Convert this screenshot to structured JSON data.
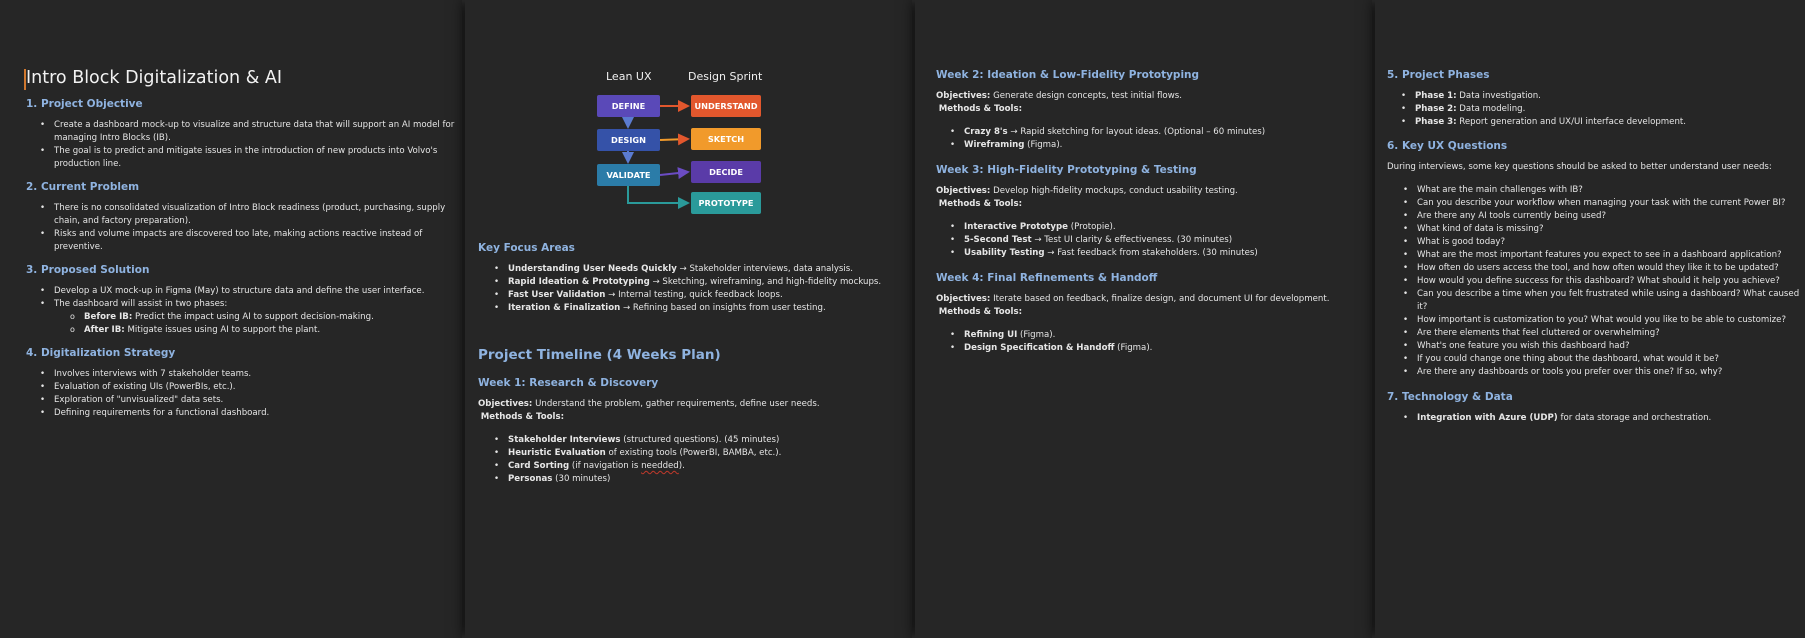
{
  "page1": {
    "title": "Intro Block Digitalization & AI",
    "sections": [
      {
        "heading": "1. Project Objective",
        "bullets": [
          "Create a dashboard mock-up to visualize and structure data that will support an AI model for managing Intro Blocks (IB).",
          "The goal is to predict and mitigate issues in the introduction of new products into Volvo's production line."
        ]
      },
      {
        "heading": "2. Current Problem",
        "bullets": [
          "There is no consolidated visualization of Intro Block readiness (product, purchasing, supply chain, and factory preparation).",
          "Risks and volume impacts are discovered too late, making actions reactive instead of preventive."
        ]
      },
      {
        "heading": "3. Proposed Solution",
        "bullets": [
          "Develop a UX mock-up in Figma (May) to structure data and define the user interface.",
          "The dashboard will assist in two phases:"
        ],
        "sub": [
          {
            "label": "Before IB:",
            "text": " Predict the impact using AI to support decision-making."
          },
          {
            "label": "After IB:",
            "text": " Mitigate issues using AI to support the plant."
          }
        ]
      },
      {
        "heading": "4. Digitalization Strategy",
        "bullets": [
          "Involves interviews with 7 stakeholder teams.",
          "Evaluation of existing UIs (PowerBIs, etc.).",
          "Exploration of \"unvisualized\" data sets.",
          "Defining requirements for a functional dashboard."
        ]
      }
    ]
  },
  "page2": {
    "diagram": {
      "left_header": "Lean UX",
      "right_header": "Design Sprint",
      "left_boxes": [
        "DEFINE",
        "DESIGN",
        "VALIDATE"
      ],
      "right_boxes": [
        "UNDERSTAND",
        "SKETCH",
        "DECIDE",
        "PROTOTYPE"
      ]
    },
    "focus_heading": "Key Focus Areas",
    "focus": [
      {
        "label": "Understanding User Needs Quickly",
        "text": " → Stakeholder interviews, data analysis."
      },
      {
        "label": "Rapid Ideation & Prototyping",
        "text": " → Sketching, wireframing, and high-fidelity mockups."
      },
      {
        "label": "Fast User Validation",
        "text": " → Internal testing, quick feedback loops."
      },
      {
        "label": "Iteration & Finalization",
        "text": " → Refining based on insights from user testing."
      }
    ],
    "timeline_heading": "Project Timeline (4 Weeks Plan)",
    "week1": {
      "heading": "Week 1: Research & Discovery",
      "objectives_label": "Objectives:",
      "objectives_text": " Understand the problem, gather requirements, define user needs.",
      "methods_label": "Methods & Tools:",
      "items": [
        {
          "label": "Stakeholder Interviews",
          "text": " (structured questions). (45 minutes)"
        },
        {
          "label": "Heuristic Evaluation",
          "text": " of existing tools (PowerBI, BAMBA, etc.)."
        },
        {
          "label": "Card Sorting",
          "text_a": " (if navigation is ",
          "spell": "needded",
          "text_b": ")."
        },
        {
          "label": "Personas",
          "text": " (30 minutes)"
        }
      ]
    }
  },
  "page3": {
    "weeks": [
      {
        "heading": "Week 2: Ideation & Low-Fidelity Prototyping",
        "objectives": " Generate design concepts, test initial flows.",
        "items": [
          {
            "label": "Crazy 8's",
            "text": " → Rapid sketching for layout ideas. (Optional – 60 minutes)"
          },
          {
            "label": "Wireframing",
            "text": " (Figma)."
          }
        ]
      },
      {
        "heading": "Week 3: High-Fidelity Prototyping & Testing",
        "objectives": " Develop high-fidelity mockups, conduct usability testing.",
        "items": [
          {
            "label": "Interactive Prototype",
            "text": " (Protopie)."
          },
          {
            "label": "5-Second Test",
            "text": " → Test UI clarity & effectiveness. (30 minutes)"
          },
          {
            "label": "Usability Testing",
            "text": " → Fast feedback from stakeholders. (30 minutes)"
          }
        ]
      },
      {
        "heading": "Week 4: Final Refinements & Handoff",
        "objectives": " Iterate based on feedback, finalize design, and document UI for development.",
        "items": [
          {
            "label": "Refining UI",
            "text": " (Figma)."
          },
          {
            "label": "Design Specification & Handoff",
            "text": " (Figma)."
          }
        ]
      }
    ],
    "objectives_label": "Objectives:",
    "methods_label": "Methods & Tools:"
  },
  "page4": {
    "phases_heading": "5. Project Phases",
    "phases": [
      {
        "label": "Phase 1:",
        "text": " Data investigation."
      },
      {
        "label": "Phase 2:",
        "text": " Data modeling."
      },
      {
        "label": "Phase 3:",
        "text": " Report generation and UX/UI interface development."
      }
    ],
    "questions_heading": "6. Key UX Questions",
    "questions_intro": "During interviews, some key questions should be asked to better understand user needs:",
    "questions": [
      "What are the main challenges with IB?",
      "Can you describe your workflow when managing your task with the current Power BI?",
      "Are there any AI tools currently being used?",
      "What kind of data is missing?",
      "What is good today?",
      "What are the most important features you expect to see in a dashboard application?",
      "How often do users access the tool, and how often would they like it to be updated?",
      "How would you define success for this dashboard? What should it help you achieve?",
      "Can you describe a time when you felt frustrated while using a dashboard? What caused it?",
      "How important is customization to you? What would you like to be able to customize?",
      "Are there elements that feel cluttered or overwhelming?",
      "What's one feature you wish this dashboard had?",
      "If you could change one thing about the dashboard, what would it be?",
      "Are there any dashboards or tools you prefer over this one? If so, why?"
    ],
    "tech_heading": "7. Technology & Data",
    "tech": [
      {
        "label": "Integration with Azure (UDP)",
        "text": " for data storage and orchestration."
      }
    ]
  }
}
